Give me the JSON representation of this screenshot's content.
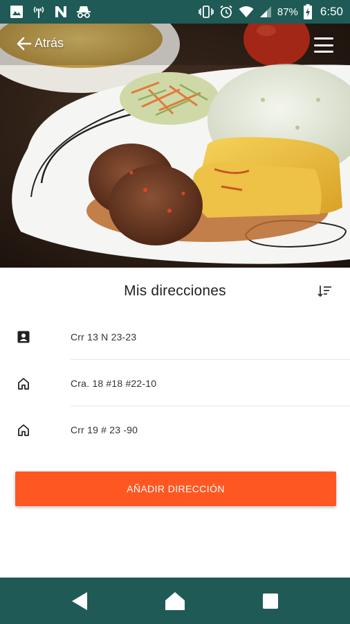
{
  "status_bar": {
    "battery_percent": "87%",
    "time": "6:50",
    "left_icons": [
      "image-icon",
      "signal-tower-icon",
      "n-notification-icon",
      "incognito-icon"
    ],
    "right_icons": [
      "vibrate-icon",
      "alarm-icon",
      "wifi-icon",
      "cell-signal-icon",
      "battery-charging-icon"
    ]
  },
  "header": {
    "back_label": "Atrás",
    "back_icon": "arrow-left-icon",
    "menu_icon": "hamburger-menu-icon"
  },
  "section": {
    "title": "Mis direcciones",
    "sort_icon": "sort-icon"
  },
  "addresses": [
    {
      "icon": "work-badge-icon",
      "label": "Crr 13 N 23-23"
    },
    {
      "icon": "home-icon",
      "label": "Cra. 18 #18 #22-10"
    },
    {
      "icon": "home-icon",
      "label": "Crr 19 # 23 -90"
    }
  ],
  "actions": {
    "add_address_label": "AÑADIR DIRECCIÓN"
  },
  "colors": {
    "primary_dark": "#1f5a56",
    "accent": "#ff5722"
  },
  "nav_bar": {
    "buttons": [
      "back-triangle-icon",
      "home-nav-icon",
      "recents-square-icon"
    ]
  }
}
